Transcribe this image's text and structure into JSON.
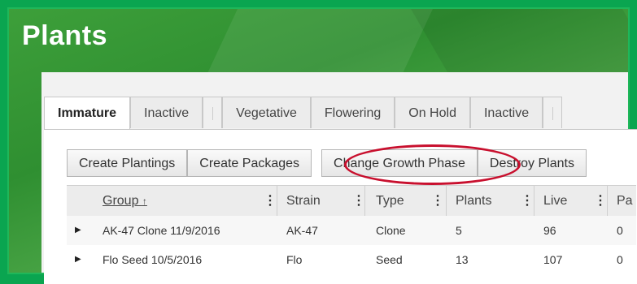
{
  "page": {
    "title": "Plants"
  },
  "tabs": [
    {
      "label": "Immature",
      "active": true
    },
    {
      "label": "Inactive",
      "active": false
    },
    {
      "label": "Vegetative",
      "active": false
    },
    {
      "label": "Flowering",
      "active": false
    },
    {
      "label": "On Hold",
      "active": false
    },
    {
      "label": "Inactive",
      "active": false
    }
  ],
  "toolbar": {
    "create_plantings": "Create Plantings",
    "create_packages": "Create Packages",
    "change_growth_phase": "Change Growth Phase",
    "destroy_plants": "Destroy Plants"
  },
  "grid": {
    "columns": {
      "group": "Group",
      "sort_indicator": "↑",
      "strain": "Strain",
      "type": "Type",
      "plants": "Plants",
      "live": "Live",
      "packages_partial": "Pa"
    },
    "rows": [
      {
        "group": "AK-47 Clone 11/9/2016",
        "strain": "AK-47",
        "type": "Clone",
        "plants": "5",
        "live": "96",
        "packages": "0"
      },
      {
        "group": "Flo Seed 10/5/2016",
        "strain": "Flo",
        "type": "Seed",
        "plants": "13",
        "live": "107",
        "packages": "0"
      }
    ]
  },
  "colors": {
    "brand_green": "#3d9f3a",
    "highlight": "#c8102e"
  },
  "icons": {
    "expand_row": "triangle-right-icon",
    "column_menu": "vertical-dots-icon"
  }
}
